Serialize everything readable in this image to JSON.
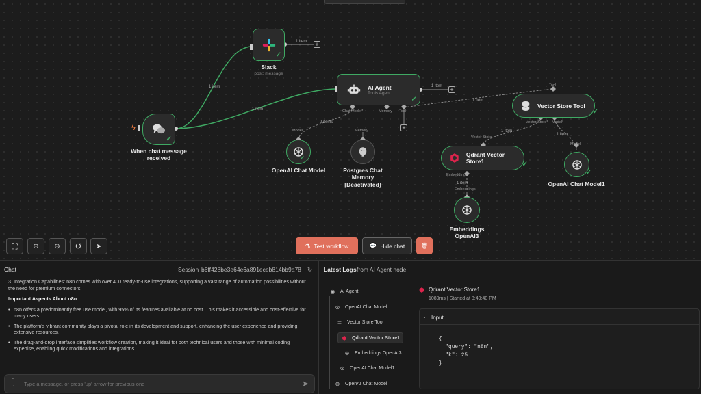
{
  "canvas": {
    "nodes": {
      "slack": {
        "title": "Slack",
        "subtitle": "post: message",
        "output_label": "1 item"
      },
      "chat_trigger": {
        "title_line1": "When chat message",
        "title_line2": "received"
      },
      "ai_agent": {
        "title": "AI Agent",
        "subtitle": "Tools Agent",
        "output_label": "1 item",
        "port_chat_model": "Chat Model*",
        "port_memory": "Memory",
        "port_tool": "Tool"
      },
      "openai_chat_model": {
        "title": "OpenAI Chat Model",
        "port_label": "Model"
      },
      "postgres_memory": {
        "title_line1": "Postgres Chat",
        "title_line2": "Memory",
        "title_line3": "[Deactivated]",
        "port_label": "Memory"
      },
      "vector_store_tool": {
        "title": "Vector Store Tool",
        "port_tool": "Tool",
        "port_vector_store": "Vector Store*",
        "port_model": "Model*"
      },
      "qdrant_vector_store": {
        "title": "Qdrant Vector Store1",
        "port_vector_store": "Vector Store",
        "port_embeddings": "Embeddings*"
      },
      "openai_chat_model1": {
        "title": "OpenAI Chat Model1",
        "port_label": "Model"
      },
      "embeddings_openai3": {
        "title_line1": "Embeddings",
        "title_line2": "OpenAI3",
        "port_label": "Embeddings"
      }
    },
    "wire_labels": {
      "trigger_to_slack": "1 item",
      "trigger_to_agent": "1 item",
      "model_to_agent": "2 items",
      "tool_to_agent": "1 item",
      "qdrant_to_tool": "1 item",
      "model1_to_tool": "1 item",
      "emb_to_qdrant": "1 item"
    }
  },
  "toolbar": {
    "test_workflow": "Test workflow",
    "hide_chat": "Hide chat"
  },
  "chat": {
    "title": "Chat",
    "session_label": "Session",
    "session_id": "b6ff428be3e64e6a891eceb814bb9a78",
    "messages": {
      "item3": "3. Integration Capabilities: n8n comes with over 400 ready-to-use integrations, supporting a vast range of automation possibilities without the need for premium connectors.",
      "heading": "Important Aspects About n8n:",
      "bullets": [
        "n8n offers a predominantly free use model, with 95% of its features available at no cost. This makes it accessible and cost-effective for many users.",
        "The platform's vibrant community plays a pivotal role in its development and support, enhancing the user experience and providing extensive resources.",
        "The drag-and-drop interface simplifies workflow creation, making it ideal for both technical users and those with minimal coding expertise, enabling quick modifications and integrations."
      ]
    },
    "input_placeholder": "Type a message, or press 'up' arrow for previous one"
  },
  "logs": {
    "title": "Latest Logs",
    "title_suffix": "from AI Agent node",
    "tree": [
      "AI Agent",
      "OpenAI Chat Model",
      "Vector Store Tool",
      "Qdrant Vector Store1",
      "Embeddings OpenAI3",
      "OpenAI Chat Model1",
      "OpenAI Chat Model"
    ],
    "detail": {
      "node_name": "Qdrant Vector Store1",
      "timing": "1089ms | Started at 8:49:40 PM |",
      "input_label": "Input",
      "json_lines": [
        "{",
        "  \"query\": \"n8n\",",
        "  \"k\": 25",
        "}"
      ]
    }
  },
  "colors": {
    "accent_green": "#3fa963",
    "test_button": "#e0705c",
    "canvas_bg": "#1c1c1c"
  }
}
